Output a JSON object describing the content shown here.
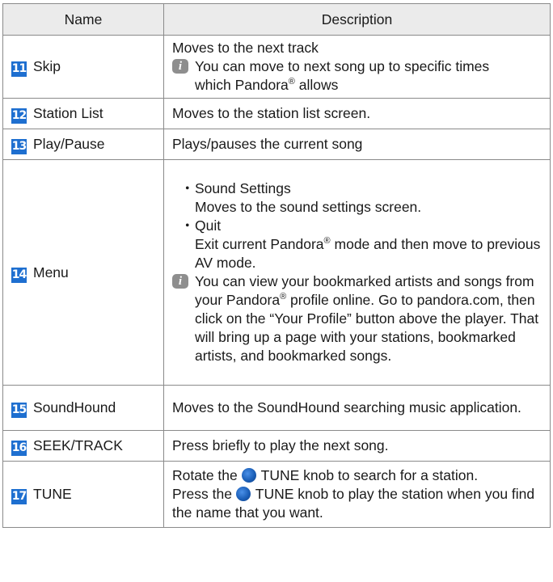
{
  "headers": {
    "name": "Name",
    "description": "Description"
  },
  "rows": [
    {
      "num": "11",
      "name": "Skip",
      "line1": "Moves to the next track",
      "note_a": "You can move to next song up to specific times",
      "note_b": "which Pandora",
      "note_c": " allows"
    },
    {
      "num": "12",
      "name": "Station List",
      "text": "Moves to the station list screen."
    },
    {
      "num": "13",
      "name": "Play/Pause",
      "text": "Plays/pauses the current song"
    },
    {
      "num": "14",
      "name": "Menu",
      "bullet1": "Sound Settings",
      "bullet1_desc": "Moves to the sound settings screen.",
      "bullet2": "Quit",
      "bullet2_desc_a": "Exit current Pandora",
      "bullet2_desc_b": " mode and then move to previous AV mode.",
      "note_a": "You can view your bookmarked artists and songs from your Pandora",
      "note_b": " profile online. Go to pandora.com, then click on the “Your Profile” button above the player. That will bring up a page with your stations, bookmarked artists, and bookmarked songs."
    },
    {
      "num": "15",
      "name": "SoundHound",
      "text": "Moves to the SoundHound searching music application."
    },
    {
      "num": "16",
      "name": "SEEK/TRACK",
      "text": "Press briefly to play the next song."
    },
    {
      "num": "17",
      "name": "TUNE",
      "line1_a": "Rotate the ",
      "line1_b": "TUNE knob to search for a station.",
      "line2_a": "Press the ",
      "line2_b": "TUNE knob to play the station when you find the name that you want."
    }
  ],
  "symbols": {
    "registered": "®",
    "bullet": "・",
    "info": "i"
  },
  "colors": {
    "badge": "#1e6fd0",
    "header_bg": "#ebebeb",
    "info_bg": "#8e8e8e"
  }
}
